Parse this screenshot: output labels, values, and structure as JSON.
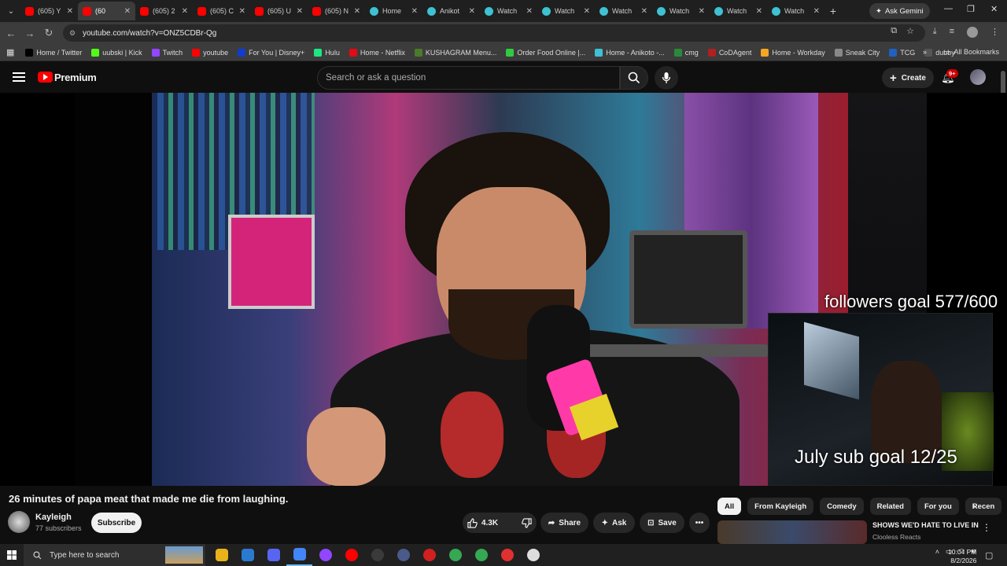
{
  "browser": {
    "tabs": [
      {
        "label": "(605) Y",
        "kind": "yt"
      },
      {
        "label": "(60",
        "kind": "yt",
        "active": true
      },
      {
        "label": "(605) 2",
        "kind": "yt"
      },
      {
        "label": "(605) C",
        "kind": "yt"
      },
      {
        "label": "(605) U",
        "kind": "yt"
      },
      {
        "label": "(605) N",
        "kind": "yt"
      },
      {
        "label": "Home",
        "kind": "an"
      },
      {
        "label": "Anikot",
        "kind": "an"
      },
      {
        "label": "Watch",
        "kind": "an"
      },
      {
        "label": "Watch",
        "kind": "an"
      },
      {
        "label": "Watch",
        "kind": "an"
      },
      {
        "label": "Watch",
        "kind": "an"
      },
      {
        "label": "Watch",
        "kind": "an"
      },
      {
        "label": "Watch",
        "kind": "an"
      }
    ],
    "gemini_label": "Ask Gemini",
    "url": "youtube.com/watch?v=ONZ5CDBr-Qg",
    "bookmarks": [
      {
        "label": "Home / Twitter",
        "color": "#000000"
      },
      {
        "label": "uubski | Kick",
        "color": "#53fc18"
      },
      {
        "label": "Twitch",
        "color": "#9146ff"
      },
      {
        "label": "youtube",
        "color": "#ff0000"
      },
      {
        "label": "For You | Disney+",
        "color": "#113ccf"
      },
      {
        "label": "Hulu",
        "color": "#1ce783"
      },
      {
        "label": "Home - Netflix",
        "color": "#e50914"
      },
      {
        "label": "KUSHAGRAM Menu...",
        "color": "#4a7a2a"
      },
      {
        "label": "Order Food Online |...",
        "color": "#2ecc40"
      },
      {
        "label": "Home - Anikoto -...",
        "color": "#3ec1d3"
      },
      {
        "label": "cmg",
        "color": "#2a8a3a"
      },
      {
        "label": "CoDAgent",
        "color": "#b02020"
      },
      {
        "label": "Home - Workday",
        "color": "#f5a623"
      },
      {
        "label": "Sneak City",
        "color": "#888888"
      },
      {
        "label": "TCG",
        "color": "#2060c0"
      },
      {
        "label": "dubby",
        "color": "#555555"
      }
    ],
    "all_bookmarks": "All Bookmarks"
  },
  "youtube": {
    "brand": "Premium",
    "search_placeholder": "Search or ask a question",
    "create_label": "Create",
    "notif_count": "9+",
    "video": {
      "overlay_followers": "followers goal 577/600",
      "overlay_subs": "July sub goal 12/25"
    },
    "title": "26 minutes of papa meat that made me die from laughing.",
    "channel": {
      "name": "Kayleigh",
      "subs": "77 subscribers"
    },
    "subscribe_label": "Subscribe",
    "actions": {
      "likes": "4.3K",
      "share": "Share",
      "ask": "Ask",
      "save": "Save"
    },
    "chips": [
      "All",
      "From Kayleigh",
      "Comedy",
      "Related",
      "For you",
      "Recen"
    ],
    "recommendation": {
      "title": "SHOWS WE'D HATE TO LIVE IN",
      "channel": "Clooless Reacts"
    }
  },
  "taskbar": {
    "search_placeholder": "Type here to search",
    "time": "10:04 PM",
    "date": "8/2/2026",
    "apps": [
      "#e8b21a",
      "#2a7ad0",
      "#5865f2",
      "#4285f4",
      "#9146ff",
      "#ff0000",
      "#3a3a3a",
      "#4a5a8a",
      "#d02020",
      "#34a853",
      "#34a853",
      "#e03030",
      "#dddddd"
    ]
  },
  "colors": {
    "accent": "#ff0000",
    "bg": "#0f0f0f"
  }
}
